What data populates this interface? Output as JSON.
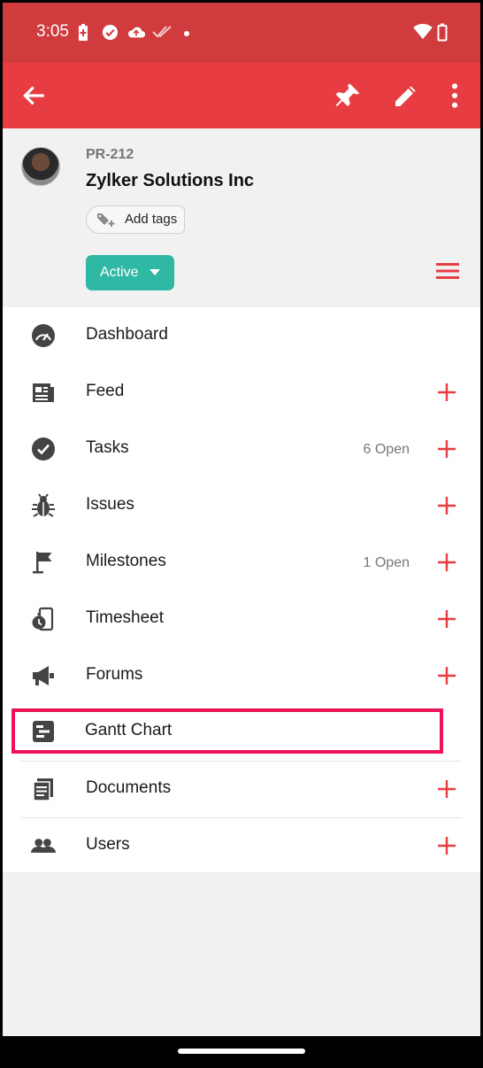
{
  "status_bar": {
    "time": "3:05"
  },
  "toolbar": {
    "back_icon": "arrow-left-icon",
    "pin_icon": "pin-icon",
    "edit_icon": "pencil-icon",
    "more_icon": "more-vertical-icon"
  },
  "project": {
    "id": "PR-212",
    "name": "Zylker Solutions Inc",
    "add_tags_label": "Add tags",
    "status_label": "Active"
  },
  "menu": [
    {
      "label": "Dashboard",
      "icon": "speedometer-icon",
      "count": "",
      "has_add": false
    },
    {
      "label": "Feed",
      "icon": "newspaper-icon",
      "count": "",
      "has_add": true
    },
    {
      "label": "Tasks",
      "icon": "check-circle-icon",
      "count": "6 Open",
      "has_add": true
    },
    {
      "label": "Issues",
      "icon": "bug-icon",
      "count": "",
      "has_add": true
    },
    {
      "label": "Milestones",
      "icon": "flag-icon",
      "count": "1 Open",
      "has_add": true
    },
    {
      "label": "Timesheet",
      "icon": "stopwatch-icon",
      "count": "",
      "has_add": true
    },
    {
      "label": "Forums",
      "icon": "megaphone-icon",
      "count": "",
      "has_add": true
    },
    {
      "label": "Gantt Chart",
      "icon": "gantt-icon",
      "count": "",
      "has_add": false
    },
    {
      "label": "Documents",
      "icon": "documents-icon",
      "count": "",
      "has_add": true
    },
    {
      "label": "Users",
      "icon": "users-icon",
      "count": "",
      "has_add": true
    }
  ],
  "colors": {
    "status_bar": "#d03b3e",
    "toolbar": "#e73c42",
    "accent": "#e73c42",
    "status_active": "#2fb8a4",
    "highlight": "#ee1256"
  }
}
